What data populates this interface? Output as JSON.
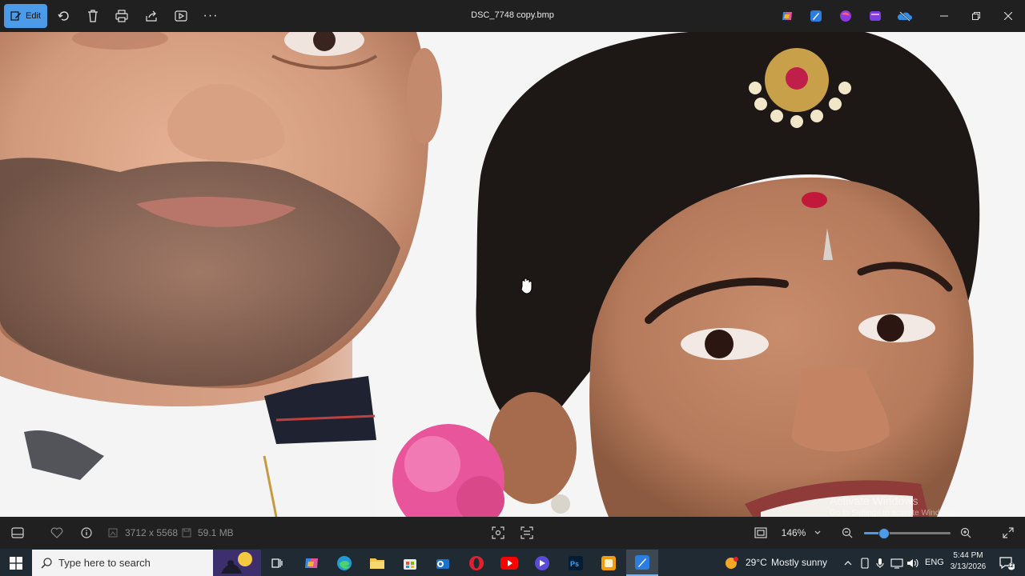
{
  "titlebar": {
    "edit_label": "Edit",
    "file_name": "DSC_7748 copy.bmp",
    "more_label": "···",
    "icons": [
      "edit-icon",
      "rotate-icon",
      "delete-icon",
      "print-icon",
      "share-icon",
      "slideshow-icon",
      "more-icon"
    ],
    "app_icons": [
      "copilot-icon",
      "photos-editor-icon",
      "clipchamp-icon",
      "designer-icon",
      "onedrive-icon"
    ],
    "window_controls": [
      "minimize-icon",
      "restore-icon",
      "close-icon"
    ]
  },
  "image": {
    "description_alt": "",
    "cursor": "hand-cursor-icon"
  },
  "statusbar": {
    "dimensions": "3712 x 5568",
    "file_size": "59.1 MB",
    "zoom_value": "146%",
    "zoom_fraction": 0.22
  },
  "watermark": {
    "line1": "Activate Windows",
    "line2": "Go to Settings to activate Windows."
  },
  "taskbar": {
    "search_placeholder": "Type here to search",
    "weather_temp": "29°C",
    "weather_text": "Mostly sunny",
    "language": "ENG",
    "time": "5:44 PM",
    "date": "3/13/2026",
    "notification_count": "12"
  },
  "colors": {
    "accent": "#4c9be8",
    "titlebar_bg": "#202020",
    "taskbar_bg": "#1f2a33"
  }
}
